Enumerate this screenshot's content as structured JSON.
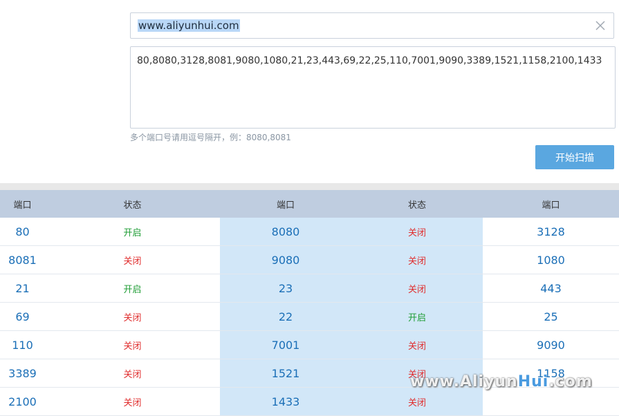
{
  "scanner": {
    "url_value": "www.aliyunhui.com",
    "ports_value": "80,8080,3128,8081,9080,1080,21,23,443,69,22,25,110,7001,9090,3389,1521,1158,2100,1433",
    "hint": "多个端口号请用逗号隔开，例：8080,8081",
    "scan_label": "开始扫描"
  },
  "table": {
    "headers": [
      "端口",
      "状态",
      "端口",
      "状态",
      "端口"
    ],
    "rows": [
      {
        "p1": "80",
        "s1": "开启",
        "s1_type": "open",
        "p2": "8080",
        "s2": "关闭",
        "s2_type": "closed",
        "p3": "3128"
      },
      {
        "p1": "8081",
        "s1": "关闭",
        "s1_type": "closed",
        "p2": "9080",
        "s2": "关闭",
        "s2_type": "closed",
        "p3": "1080"
      },
      {
        "p1": "21",
        "s1": "开启",
        "s1_type": "open",
        "p2": "23",
        "s2": "关闭",
        "s2_type": "closed",
        "p3": "443"
      },
      {
        "p1": "69",
        "s1": "关闭",
        "s1_type": "closed",
        "p2": "22",
        "s2": "开启",
        "s2_type": "open",
        "p3": "25"
      },
      {
        "p1": "110",
        "s1": "关闭",
        "s1_type": "closed",
        "p2": "7001",
        "s2": "关闭",
        "s2_type": "closed",
        "p3": "9090"
      },
      {
        "p1": "3389",
        "s1": "关闭",
        "s1_type": "closed",
        "p2": "1521",
        "s2": "关闭",
        "s2_type": "closed",
        "p3": "1158"
      },
      {
        "p1": "2100",
        "s1": "关闭",
        "s1_type": "closed",
        "p2": "1433",
        "s2": "关闭",
        "s2_type": "closed",
        "p3": ""
      }
    ]
  },
  "watermark": {
    "prefix": "www.Aliyun",
    "highlight": "Hui",
    "suffix": ".com"
  },
  "colors": {
    "open": "#1f9d35",
    "closed": "#e02d2d",
    "port": "#1b6fb7",
    "button": "#5aa7e0"
  }
}
